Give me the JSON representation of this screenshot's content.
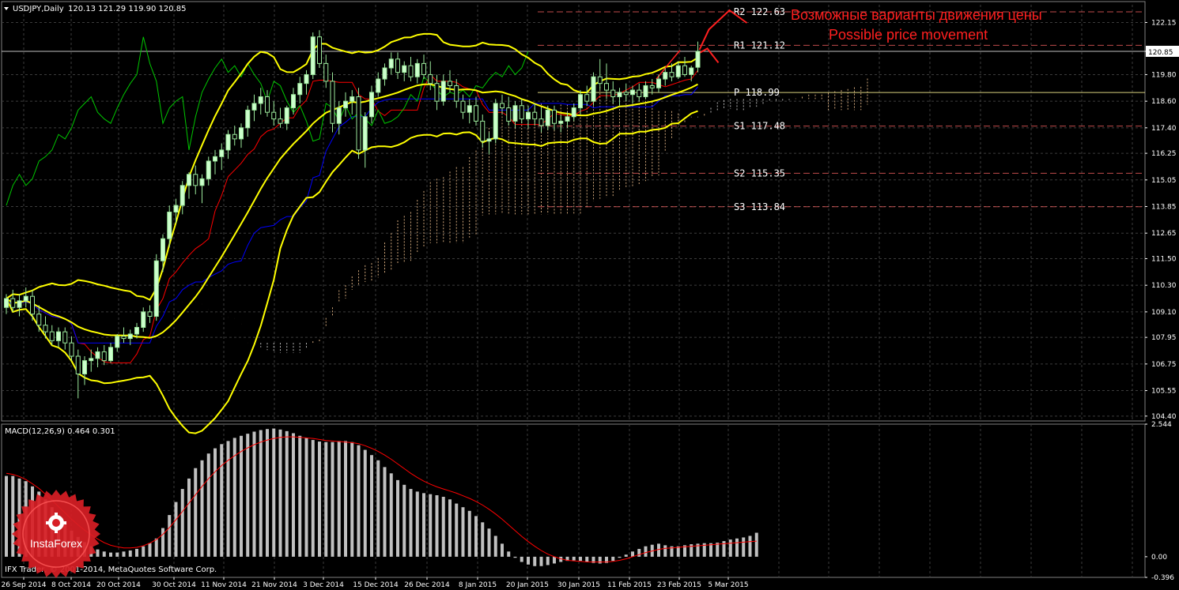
{
  "header": {
    "symbol": "USDJPY,Daily",
    "ohlc": "120.13 121.29 119.90 120.85",
    "macd_label": "MACD(12,26,9) 0.464 0.301",
    "copyright": "IFX Trader, © 2001-2014, MetaQuotes Software Corp."
  },
  "annotation": {
    "line1": "Возможные варианты движения цены",
    "line2": "Possible price movement"
  },
  "logo": {
    "text": "InstaForex"
  },
  "colors": {
    "background": "#000000",
    "grid": "#3c3c3c",
    "bull_candle": "#ccffcc",
    "bear_candle": "#000000",
    "candle_wick": "#9be89b",
    "bollinger": "#ffff00",
    "tenkan": "#ff0000",
    "kijun": "#0000ff",
    "chikou": "#00c800",
    "kumo_a": "#f4c390",
    "kumo_b": "#d8d8d8",
    "macd_hist": "#c0c0c0",
    "macd_signal": "#ff0000",
    "pivot_line": "#ff6666",
    "pivot_p_line": "#f0e68c",
    "annotation": "#ff2020",
    "current_price_line": "#c0c0c0"
  },
  "chart_data": [
    {
      "type": "candlestick",
      "title": "USDJPY,Daily",
      "x": [
        "26 Sep 2014",
        "8 Oct 2014",
        "20 Oct 2014",
        "30 Oct 2014",
        "11 Nov 2014",
        "21 Nov 2014",
        "3 Dec 2014",
        "15 Dec 2014",
        "26 Dec 2014",
        "8 Jan 2015",
        "20 Jan 2015",
        "30 Jan 2015",
        "11 Feb 2015",
        "23 Feb 2015",
        "5 Mar 2015"
      ],
      "y_ticks": [
        104.4,
        105.55,
        106.75,
        107.95,
        109.1,
        110.3,
        111.5,
        112.65,
        113.85,
        115.05,
        116.25,
        117.4,
        118.6,
        119.8,
        120.85,
        122.15
      ],
      "ylim": [
        104.18,
        122.95
      ],
      "current_price": 120.85,
      "pivot_levels": [
        {
          "name": "R2",
          "value": 122.63,
          "label": "R2 122.63"
        },
        {
          "name": "R1",
          "value": 121.12,
          "label": "R1 121.12"
        },
        {
          "name": "P",
          "value": 118.99,
          "label": "P 118.99"
        },
        {
          "name": "S1",
          "value": 117.48,
          "label": "S1 117.48"
        },
        {
          "name": "S2",
          "value": 115.35,
          "label": "S2 115.35"
        },
        {
          "name": "S3",
          "value": 113.84,
          "label": "S3 113.84"
        }
      ],
      "candles": [
        [
          109.3,
          109.9,
          109.0,
          109.7
        ],
        [
          109.7,
          110.1,
          109.1,
          109.3
        ],
        [
          109.3,
          109.9,
          108.9,
          109.6
        ],
        [
          109.6,
          110.2,
          109.3,
          109.8
        ],
        [
          109.8,
          110.1,
          108.7,
          109.0
        ],
        [
          109.0,
          109.4,
          108.2,
          108.5
        ],
        [
          108.5,
          108.9,
          107.9,
          108.2
        ],
        [
          108.2,
          108.5,
          107.6,
          107.8
        ],
        [
          107.8,
          108.4,
          107.5,
          108.2
        ],
        [
          108.2,
          108.4,
          107.4,
          107.7
        ],
        [
          107.7,
          108.0,
          106.9,
          107.1
        ],
        [
          107.1,
          107.4,
          105.2,
          106.3
        ],
        [
          106.3,
          107.1,
          105.8,
          106.9
        ],
        [
          106.9,
          107.4,
          106.4,
          107.0
        ],
        [
          107.0,
          107.5,
          106.6,
          107.3
        ],
        [
          107.3,
          107.6,
          106.7,
          106.9
        ],
        [
          106.9,
          107.7,
          106.8,
          107.5
        ],
        [
          107.5,
          108.1,
          107.3,
          108.0
        ],
        [
          108.0,
          108.4,
          107.7,
          107.9
        ],
        [
          107.9,
          108.3,
          107.6,
          108.1
        ],
        [
          108.1,
          108.6,
          107.9,
          108.4
        ],
        [
          108.4,
          109.3,
          108.2,
          109.1
        ],
        [
          109.1,
          109.4,
          108.6,
          108.9
        ],
        [
          108.9,
          111.7,
          108.7,
          111.4
        ],
        [
          111.4,
          112.6,
          110.9,
          112.4
        ],
        [
          112.4,
          113.9,
          112.0,
          113.6
        ],
        [
          113.6,
          114.2,
          113.1,
          113.9
        ],
        [
          113.9,
          115.0,
          113.5,
          114.8
        ],
        [
          114.8,
          115.4,
          114.2,
          115.3
        ],
        [
          115.3,
          115.7,
          114.4,
          114.8
        ],
        [
          114.8,
          115.3,
          114.0,
          115.1
        ],
        [
          115.1,
          116.1,
          114.8,
          115.9
        ],
        [
          115.9,
          116.4,
          115.3,
          116.1
        ],
        [
          116.1,
          116.7,
          115.5,
          116.4
        ],
        [
          116.4,
          117.3,
          116.0,
          117.1
        ],
        [
          117.1,
          117.5,
          116.6,
          116.9
        ],
        [
          116.9,
          117.6,
          116.5,
          117.4
        ],
        [
          117.4,
          118.4,
          117.0,
          118.2
        ],
        [
          118.2,
          118.9,
          117.7,
          118.5
        ],
        [
          118.5,
          119.2,
          118.0,
          118.8
        ],
        [
          118.8,
          119.1,
          117.9,
          118.1
        ],
        [
          118.1,
          118.6,
          117.5,
          117.8
        ],
        [
          117.8,
          118.3,
          117.4,
          117.6
        ],
        [
          117.6,
          118.4,
          117.3,
          118.3
        ],
        [
          118.3,
          119.2,
          118.0,
          118.9
        ],
        [
          118.9,
          119.7,
          118.5,
          119.4
        ],
        [
          119.4,
          120.0,
          118.9,
          119.8
        ],
        [
          119.8,
          121.7,
          119.6,
          121.5
        ],
        [
          121.5,
          121.8,
          120.1,
          120.3
        ],
        [
          120.3,
          120.7,
          119.2,
          119.5
        ],
        [
          119.5,
          119.9,
          117.2,
          117.6
        ],
        [
          117.6,
          118.6,
          117.1,
          118.3
        ],
        [
          118.3,
          119.0,
          117.9,
          118.6
        ],
        [
          118.6,
          119.1,
          118.0,
          118.8
        ],
        [
          118.8,
          119.2,
          116.0,
          116.4
        ],
        [
          116.4,
          118.1,
          115.6,
          117.9
        ],
        [
          117.9,
          119.3,
          117.6,
          119.0
        ],
        [
          119.0,
          119.9,
          118.8,
          119.6
        ],
        [
          119.6,
          120.3,
          119.3,
          120.1
        ],
        [
          120.1,
          120.8,
          119.8,
          120.5
        ],
        [
          120.5,
          120.8,
          119.6,
          119.9
        ],
        [
          119.9,
          120.4,
          119.5,
          120.2
        ],
        [
          120.2,
          120.6,
          119.5,
          119.7
        ],
        [
          119.7,
          120.5,
          119.4,
          120.3
        ],
        [
          120.3,
          120.7,
          119.6,
          119.8
        ],
        [
          119.8,
          120.4,
          119.1,
          119.4
        ],
        [
          119.4,
          119.8,
          118.2,
          118.6
        ],
        [
          118.6,
          119.8,
          118.4,
          119.5
        ],
        [
          119.5,
          120.0,
          119.0,
          119.3
        ],
        [
          119.3,
          119.6,
          118.3,
          118.6
        ],
        [
          118.6,
          118.9,
          117.8,
          118.1
        ],
        [
          118.1,
          118.7,
          117.6,
          118.4
        ],
        [
          118.4,
          118.8,
          117.5,
          117.7
        ],
        [
          117.7,
          118.0,
          116.5,
          116.8
        ],
        [
          116.8,
          117.2,
          116.2,
          116.9
        ],
        [
          116.9,
          118.7,
          116.7,
          118.5
        ],
        [
          118.5,
          118.9,
          118.0,
          118.3
        ],
        [
          118.3,
          118.8,
          117.5,
          117.7
        ],
        [
          117.7,
          118.6,
          117.4,
          118.4
        ],
        [
          118.4,
          118.7,
          117.6,
          117.8
        ],
        [
          117.8,
          118.4,
          117.4,
          118.1
        ],
        [
          118.1,
          118.5,
          117.5,
          117.8
        ],
        [
          117.8,
          118.3,
          117.2,
          117.5
        ],
        [
          117.5,
          118.4,
          117.3,
          118.2
        ],
        [
          118.2,
          118.4,
          117.3,
          117.6
        ],
        [
          117.6,
          118.0,
          117.2,
          117.7
        ],
        [
          117.7,
          118.1,
          117.4,
          117.9
        ],
        [
          117.9,
          118.5,
          117.7,
          118.3
        ],
        [
          118.3,
          119.1,
          118.0,
          118.9
        ],
        [
          118.9,
          119.3,
          118.4,
          118.6
        ],
        [
          118.6,
          119.9,
          118.4,
          119.7
        ],
        [
          119.7,
          120.5,
          119.1,
          119.4
        ],
        [
          119.4,
          120.3,
          118.7,
          119.1
        ],
        [
          119.1,
          119.5,
          118.5,
          118.8
        ],
        [
          118.8,
          119.2,
          118.4,
          119.0
        ],
        [
          119.0,
          119.4,
          118.6,
          118.9
        ],
        [
          118.9,
          119.3,
          118.5,
          119.1
        ],
        [
          119.1,
          119.4,
          118.6,
          118.8
        ],
        [
          118.8,
          119.5,
          118.7,
          119.3
        ],
        [
          119.3,
          119.6,
          118.9,
          119.2
        ],
        [
          119.2,
          119.8,
          119.0,
          119.6
        ],
        [
          119.6,
          120.1,
          119.3,
          119.9
        ],
        [
          119.9,
          120.3,
          119.5,
          119.7
        ],
        [
          119.7,
          120.4,
          119.6,
          120.2
        ],
        [
          120.2,
          120.6,
          119.7,
          119.8
        ],
        [
          119.8,
          120.2,
          119.5,
          120.1
        ],
        [
          120.13,
          121.29,
          119.9,
          120.85
        ]
      ]
    },
    {
      "type": "bar",
      "title": "MACD(12,26,9) 0.464 0.301",
      "y_ticks": [
        2.544,
        0.0,
        -0.396
      ],
      "ylim": [
        -0.396,
        2.544
      ],
      "histogram": [
        1.55,
        1.55,
        1.5,
        1.45,
        1.35,
        1.25,
        1.1,
        0.95,
        0.8,
        0.65,
        0.5,
        0.38,
        0.28,
        0.2,
        0.14,
        0.1,
        0.08,
        0.08,
        0.1,
        0.12,
        0.15,
        0.2,
        0.26,
        0.35,
        0.55,
        0.8,
        1.05,
        1.3,
        1.5,
        1.7,
        1.85,
        1.98,
        2.08,
        2.16,
        2.22,
        2.28,
        2.32,
        2.36,
        2.4,
        2.43,
        2.45,
        2.46,
        2.44,
        2.41,
        2.37,
        2.32,
        2.28,
        2.24,
        2.21,
        2.2,
        2.2,
        2.22,
        2.22,
        2.2,
        2.14,
        2.05,
        1.95,
        1.85,
        1.72,
        1.6,
        1.47,
        1.38,
        1.3,
        1.25,
        1.22,
        1.2,
        1.18,
        1.15,
        1.1,
        1.02,
        0.95,
        0.88,
        0.78,
        0.66,
        0.54,
        0.4,
        0.25,
        0.1,
        -0.02,
        -0.1,
        -0.15,
        -0.18,
        -0.18,
        -0.16,
        -0.13,
        -0.1,
        -0.08,
        -0.07,
        -0.08,
        -0.1,
        -0.12,
        -0.13,
        -0.12,
        -0.08,
        -0.02,
        0.04,
        0.1,
        0.15,
        0.2,
        0.23,
        0.25,
        0.22,
        0.2,
        0.2,
        0.22,
        0.24,
        0.25,
        0.26,
        0.26,
        0.27,
        0.3,
        0.33,
        0.35,
        0.37,
        0.4,
        0.46
      ],
      "signal": [
        1.6,
        1.58,
        1.54,
        1.48,
        1.4,
        1.31,
        1.2,
        1.08,
        0.96,
        0.84,
        0.72,
        0.61,
        0.51,
        0.42,
        0.34,
        0.27,
        0.22,
        0.19,
        0.17,
        0.17,
        0.18,
        0.21,
        0.26,
        0.33,
        0.43,
        0.56,
        0.71,
        0.87,
        1.03,
        1.19,
        1.35,
        1.5,
        1.63,
        1.75,
        1.85,
        1.94,
        2.02,
        2.09,
        2.15,
        2.2,
        2.24,
        2.27,
        2.29,
        2.3,
        2.3,
        2.29,
        2.28,
        2.27,
        2.25,
        2.23,
        2.22,
        2.21,
        2.2,
        2.19,
        2.17,
        2.13,
        2.08,
        2.02,
        1.95,
        1.87,
        1.78,
        1.69,
        1.6,
        1.52,
        1.45,
        1.39,
        1.34,
        1.3,
        1.26,
        1.22,
        1.17,
        1.12,
        1.06,
        0.99,
        0.91,
        0.82,
        0.72,
        0.61,
        0.5,
        0.39,
        0.29,
        0.2,
        0.12,
        0.05,
        0.0,
        -0.04,
        -0.07,
        -0.08,
        -0.09,
        -0.1,
        -0.1,
        -0.1,
        -0.1,
        -0.09,
        -0.07,
        -0.04,
        0.0,
        0.04,
        0.08,
        0.11,
        0.14,
        0.16,
        0.17,
        0.18,
        0.19,
        0.2,
        0.21,
        0.22,
        0.23,
        0.24,
        0.25,
        0.26,
        0.27,
        0.28,
        0.29,
        0.3
      ]
    }
  ]
}
